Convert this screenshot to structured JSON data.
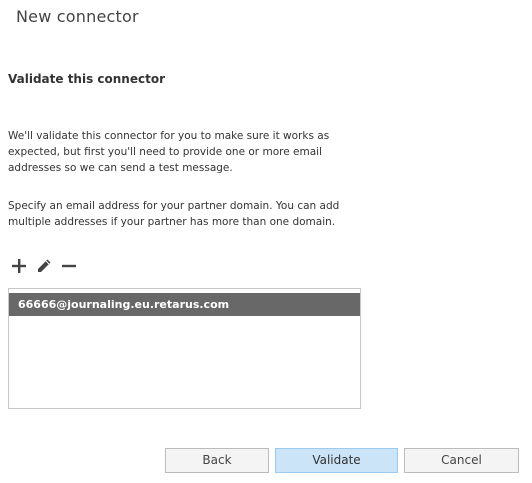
{
  "window": {
    "title": "New connector"
  },
  "page": {
    "section_title": "Validate this connector",
    "paragraph_1": "We'll validate this connector for you to make sure it works as expected, but first you'll need to provide one or more email addresses so we can send a test message.",
    "paragraph_2": "Specify an email address for your partner domain. You can add multiple addresses if your partner has more than one domain."
  },
  "toolbar": {
    "icons": [
      "add-icon",
      "edit-icon",
      "remove-icon"
    ]
  },
  "address_list": {
    "items": [
      {
        "label": "66666@journaling.eu.retarus.com",
        "selected": true
      }
    ]
  },
  "buttons": {
    "back_label": "Back",
    "validate_label": "Validate",
    "cancel_label": "Cancel"
  },
  "colors": {
    "selected_row": "#686868",
    "primary_button": "#cce4f7",
    "icon": "#444444"
  }
}
